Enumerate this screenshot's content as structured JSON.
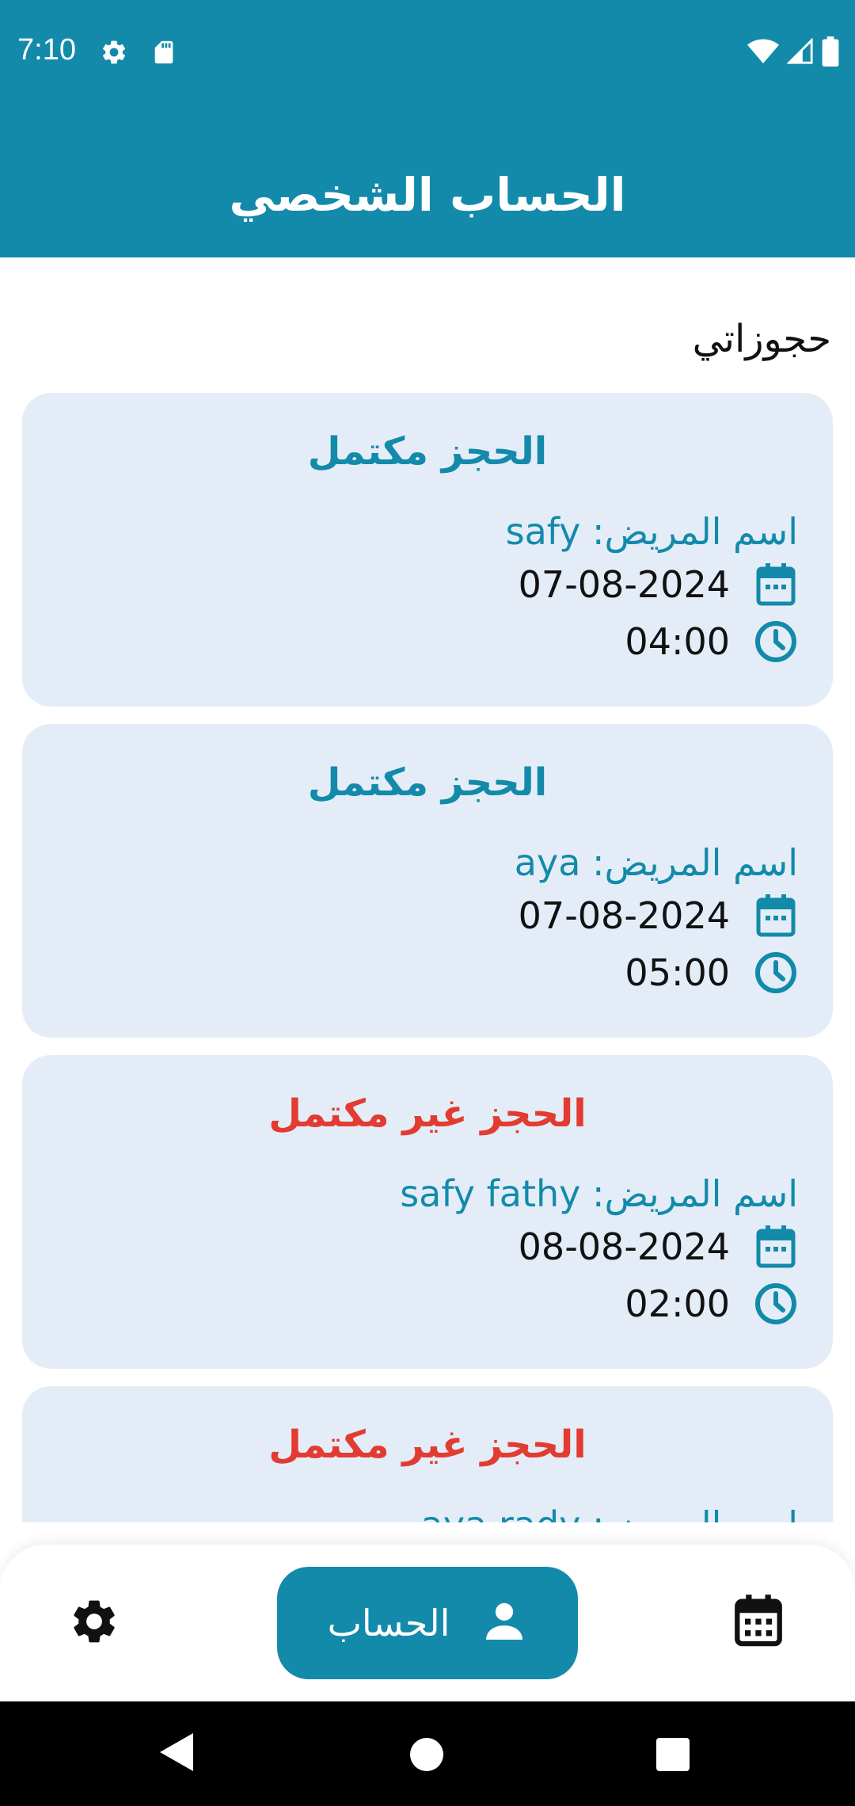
{
  "status_bar": {
    "time": "7:10",
    "icons": [
      "gear-icon",
      "sd-card-icon",
      "wifi-icon",
      "signal-icon",
      "battery-icon"
    ]
  },
  "app_bar": {
    "title": "الحساب الشخصي"
  },
  "section": {
    "title": "حجوزاتي"
  },
  "bookings": [
    {
      "status": "الحجز مكتمل",
      "status_type": "complete",
      "patient": "اسم المريض: safy",
      "date": "07-08-2024",
      "time": "04:00"
    },
    {
      "status": "الحجز مكتمل",
      "status_type": "complete",
      "patient": "اسم المريض: aya",
      "date": "07-08-2024",
      "time": "05:00"
    },
    {
      "status": "الحجز غير مكتمل",
      "status_type": "incomplete",
      "patient": "اسم المريض: safy fathy",
      "date": "08-08-2024",
      "time": "02:00"
    },
    {
      "status": "الحجز غير مكتمل",
      "status_type": "incomplete",
      "patient": "اسم المريض: aya rady",
      "date": "",
      "time": ""
    }
  ],
  "bottom_nav": {
    "profile_label": "الحساب",
    "items": [
      "settings-icon",
      "person-icon",
      "calendar-icon"
    ]
  },
  "colors": {
    "primary": "#138aaa",
    "incomplete": "#e23c32",
    "card_bg": "#e4edf7"
  }
}
